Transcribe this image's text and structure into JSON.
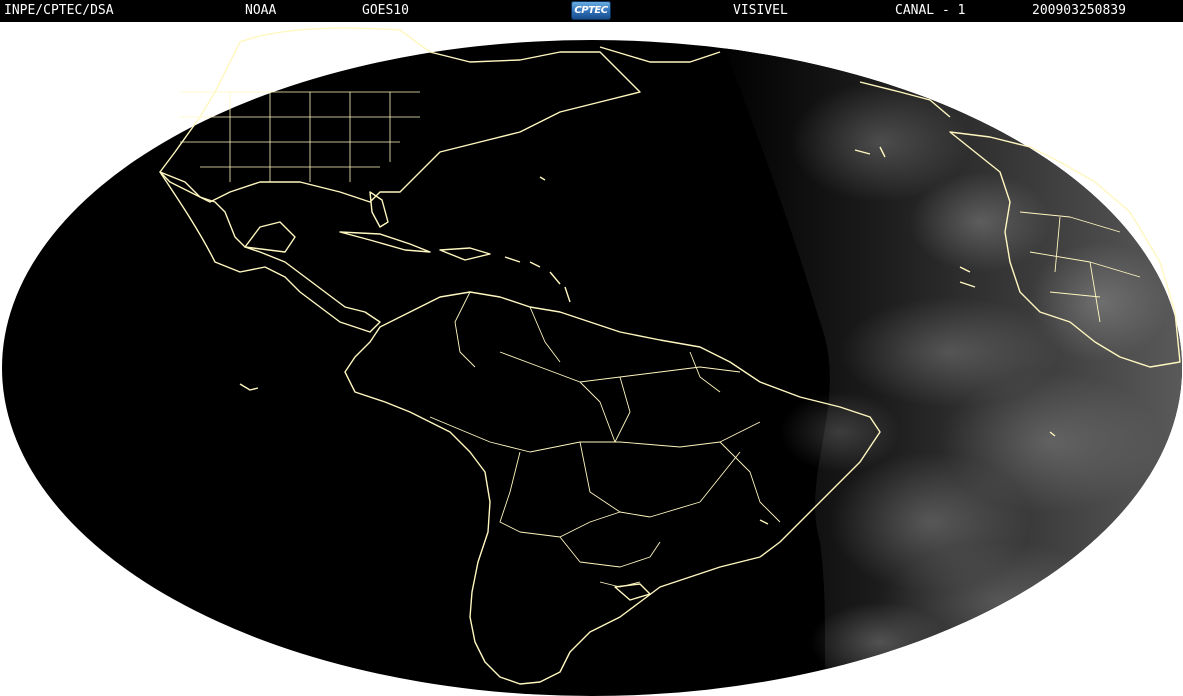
{
  "header": {
    "institution": "INPE/CPTEC/DSA",
    "agency": "NOAA",
    "satellite": "GOES10",
    "logo_text": "CPTEC",
    "channel_name": "VISIVEL",
    "channel": "CANAL - 1",
    "timestamp": "200903250839"
  },
  "colors": {
    "header_bg": "#000000",
    "header_text": "#ffffff",
    "page_bg": "#ffffff",
    "disk_dark": "#000000",
    "disk_day": "#4a4a4a",
    "coastline": "#fff7c0"
  },
  "icons": {
    "logo": "cptec-logo-icon"
  }
}
